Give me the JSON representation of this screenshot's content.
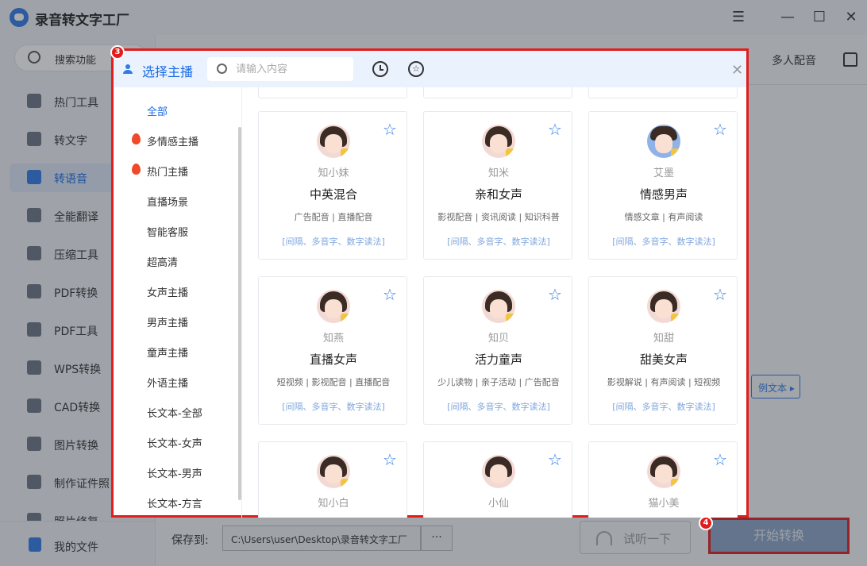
{
  "app": {
    "title": "录音转文字工厂"
  },
  "window": {
    "menu_icon": "menu-icon",
    "minimize_icon": "minimize-icon",
    "maximize_icon": "maximize-icon",
    "close_icon": "close-icon"
  },
  "sidebar": {
    "search_label": "搜索功能",
    "items": [
      {
        "label": "热门工具"
      },
      {
        "label": "转文字"
      },
      {
        "label": "转语音"
      },
      {
        "label": "全能翻译"
      },
      {
        "label": "压缩工具"
      },
      {
        "label": "PDF转换"
      },
      {
        "label": "PDF工具"
      },
      {
        "label": "WPS转换"
      },
      {
        "label": "CAD转换"
      },
      {
        "label": "图片转换"
      },
      {
        "label": "制作证件照"
      },
      {
        "label": "照片修复"
      }
    ],
    "my_files": "我的文件"
  },
  "header_right": {
    "multi_voice": "多人配音"
  },
  "bottom": {
    "save_to_label": "保存到:",
    "save_path": "C:\\Users\\user\\Desktop\\录音转文字工厂",
    "more_label": "···",
    "listen_label": "试听一下",
    "start_label": "开始转换"
  },
  "badges": {
    "dialog": "3",
    "start": "4"
  },
  "dialog": {
    "title": "选择主播",
    "search_placeholder": "请输入内容",
    "categories": [
      {
        "label": "全部",
        "selected": true
      },
      {
        "label": "多情感主播",
        "hot": true
      },
      {
        "label": "热门主播",
        "hot": true
      },
      {
        "label": "直播场景"
      },
      {
        "label": "智能客服"
      },
      {
        "label": "超高清"
      },
      {
        "label": "女声主播"
      },
      {
        "label": "男声主播"
      },
      {
        "label": "童声主播"
      },
      {
        "label": "外语主播"
      },
      {
        "label": "长文本-全部"
      },
      {
        "label": "长文本-女声"
      },
      {
        "label": "长文本-男声"
      },
      {
        "label": "长文本-方言"
      }
    ],
    "voices": [
      {
        "name": "知小妹",
        "title": "中英混合",
        "tags": "广告配音 | 直播配音",
        "features": "[间隔、多音字、数字读法]"
      },
      {
        "name": "知米",
        "title": "亲和女声",
        "tags": "影视配音 | 资讯阅读 | 知识科普",
        "features": "[间隔、多音字、数字读法]"
      },
      {
        "name": "艾墨",
        "title": "情感男声",
        "tags": "情感文章 | 有声阅读",
        "features": "[间隔、多音字、数字读法]"
      },
      {
        "name": "知燕",
        "title": "直播女声",
        "tags": "短视频 | 影视配音 | 直播配音",
        "features": "[间隔、多音字、数字读法]"
      },
      {
        "name": "知贝",
        "title": "活力童声",
        "tags": "少儿读物 | 亲子活动 | 广告配音",
        "features": "[间隔、多音字、数字读法]"
      },
      {
        "name": "知甜",
        "title": "甜美女声",
        "tags": "影视解说 | 有声阅读 | 短视频",
        "features": "[间隔、多音字、数字读法]"
      },
      {
        "name": "知小白",
        "title": "",
        "tags": "",
        "features": ""
      },
      {
        "name": "小仙",
        "title": "",
        "tags": "",
        "features": ""
      },
      {
        "name": "猫小美",
        "title": "",
        "tags": "",
        "features": ""
      }
    ]
  },
  "behind": {
    "example_text": "例文本"
  },
  "colors": {
    "accent": "#2f7be6",
    "highlight_border": "#e11d1d"
  }
}
